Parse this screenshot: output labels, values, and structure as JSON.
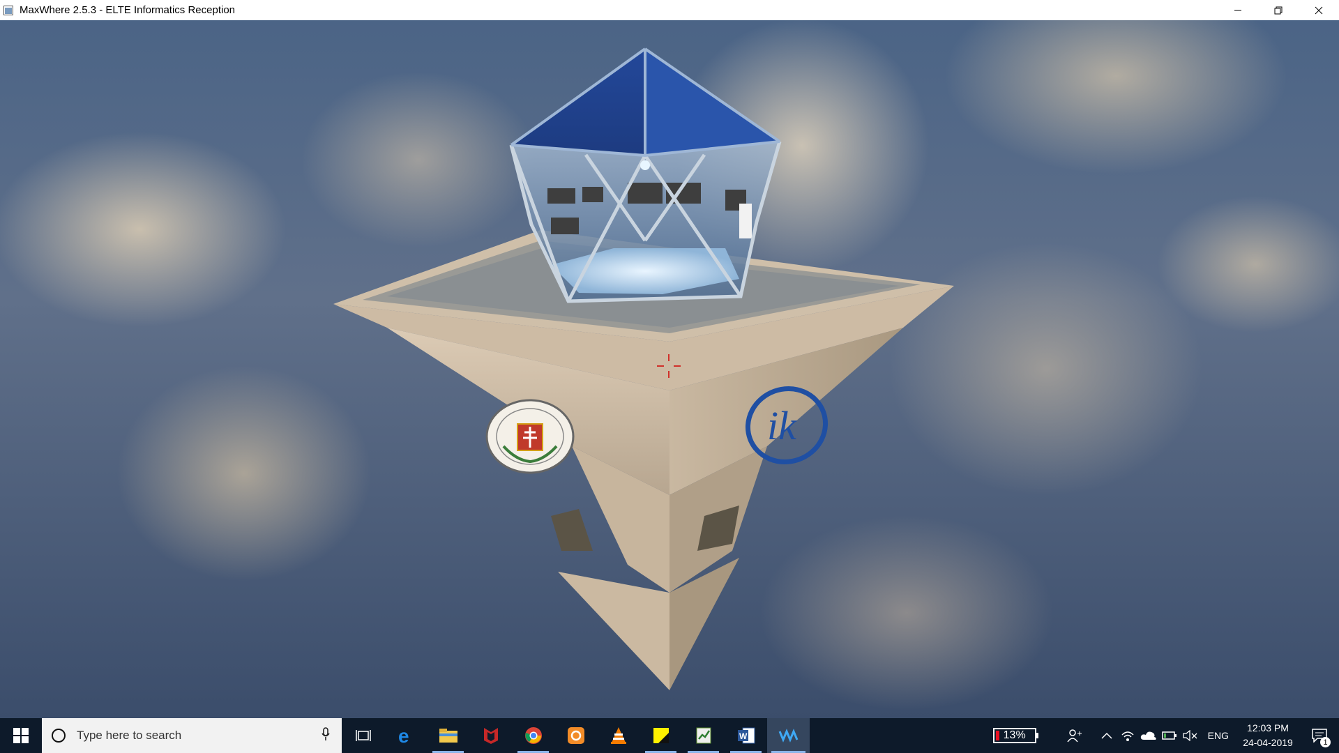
{
  "window": {
    "title": "MaxWhere 2.5.3 - ELTE Informatics Reception"
  },
  "scene": {
    "emblem_right_text": "ik",
    "crosshair_color": "#d0302a"
  },
  "taskbar": {
    "search_placeholder": "Type here to search",
    "pinned": [
      {
        "name": "task-view-icon"
      },
      {
        "name": "edge-icon"
      },
      {
        "name": "file-explorer-icon"
      },
      {
        "name": "mcafee-icon"
      },
      {
        "name": "chrome-icon"
      },
      {
        "name": "orange-app-icon"
      },
      {
        "name": "vlc-icon"
      },
      {
        "name": "sticky-notes-icon"
      },
      {
        "name": "green-app-icon"
      },
      {
        "name": "word-icon"
      },
      {
        "name": "maxwhere-icon"
      }
    ],
    "battery_percent": "13%",
    "language": "ENG",
    "time": "12:03 PM",
    "date": "24-04-2019",
    "notification_count": "1"
  }
}
